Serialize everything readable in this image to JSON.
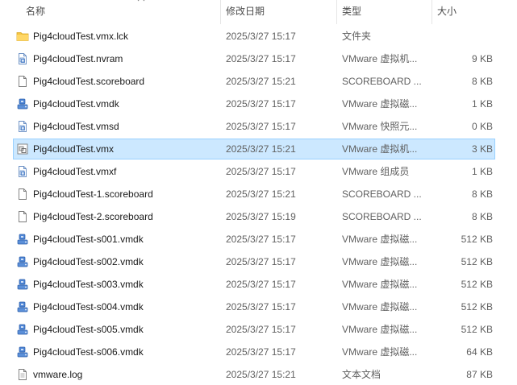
{
  "columns": {
    "name": "名称",
    "date": "修改日期",
    "type": "类型",
    "size": "大小"
  },
  "colors": {
    "selected_bg": "#cce8ff",
    "selected_border": "#99d1ff",
    "folder": "#f4c542"
  },
  "files": [
    {
      "name": "Pig4cloudTest.vmx.lck",
      "date": "2025/3/27 15:17",
      "type": "文件夹",
      "size": "",
      "icon": "folder-icon"
    },
    {
      "name": "Pig4cloudTest.nvram",
      "date": "2025/3/27 15:17",
      "type": "VMware 虚拟机...",
      "size": "9 KB",
      "icon": "vmware-file-icon"
    },
    {
      "name": "Pig4cloudTest.scoreboard",
      "date": "2025/3/27 15:21",
      "type": "SCOREBOARD ...",
      "size": "8 KB",
      "icon": "document-icon"
    },
    {
      "name": "Pig4cloudTest.vmdk",
      "date": "2025/3/27 15:17",
      "type": "VMware 虚拟磁...",
      "size": "1 KB",
      "icon": "vmware-disk-icon"
    },
    {
      "name": "Pig4cloudTest.vmsd",
      "date": "2025/3/27 15:17",
      "type": "VMware 快照元...",
      "size": "0 KB",
      "icon": "vmware-file-icon"
    },
    {
      "name": "Pig4cloudTest.vmx",
      "date": "2025/3/27 15:21",
      "type": "VMware 虚拟机...",
      "size": "3 KB",
      "icon": "vmware-vm-icon",
      "selected": true
    },
    {
      "name": "Pig4cloudTest.vmxf",
      "date": "2025/3/27 15:17",
      "type": "VMware 组成员",
      "size": "1 KB",
      "icon": "vmware-file-icon"
    },
    {
      "name": "Pig4cloudTest-1.scoreboard",
      "date": "2025/3/27 15:21",
      "type": "SCOREBOARD ...",
      "size": "8 KB",
      "icon": "document-icon"
    },
    {
      "name": "Pig4cloudTest-2.scoreboard",
      "date": "2025/3/27 15:19",
      "type": "SCOREBOARD ...",
      "size": "8 KB",
      "icon": "document-icon"
    },
    {
      "name": "Pig4cloudTest-s001.vmdk",
      "date": "2025/3/27 15:17",
      "type": "VMware 虚拟磁...",
      "size": "512 KB",
      "icon": "vmware-disk-icon"
    },
    {
      "name": "Pig4cloudTest-s002.vmdk",
      "date": "2025/3/27 15:17",
      "type": "VMware 虚拟磁...",
      "size": "512 KB",
      "icon": "vmware-disk-icon"
    },
    {
      "name": "Pig4cloudTest-s003.vmdk",
      "date": "2025/3/27 15:17",
      "type": "VMware 虚拟磁...",
      "size": "512 KB",
      "icon": "vmware-disk-icon"
    },
    {
      "name": "Pig4cloudTest-s004.vmdk",
      "date": "2025/3/27 15:17",
      "type": "VMware 虚拟磁...",
      "size": "512 KB",
      "icon": "vmware-disk-icon"
    },
    {
      "name": "Pig4cloudTest-s005.vmdk",
      "date": "2025/3/27 15:17",
      "type": "VMware 虚拟磁...",
      "size": "512 KB",
      "icon": "vmware-disk-icon"
    },
    {
      "name": "Pig4cloudTest-s006.vmdk",
      "date": "2025/3/27 15:17",
      "type": "VMware 虚拟磁...",
      "size": "64 KB",
      "icon": "vmware-disk-icon"
    },
    {
      "name": "vmware.log",
      "date": "2025/3/27 15:21",
      "type": "文本文档",
      "size": "87 KB",
      "icon": "text-document-icon"
    }
  ]
}
